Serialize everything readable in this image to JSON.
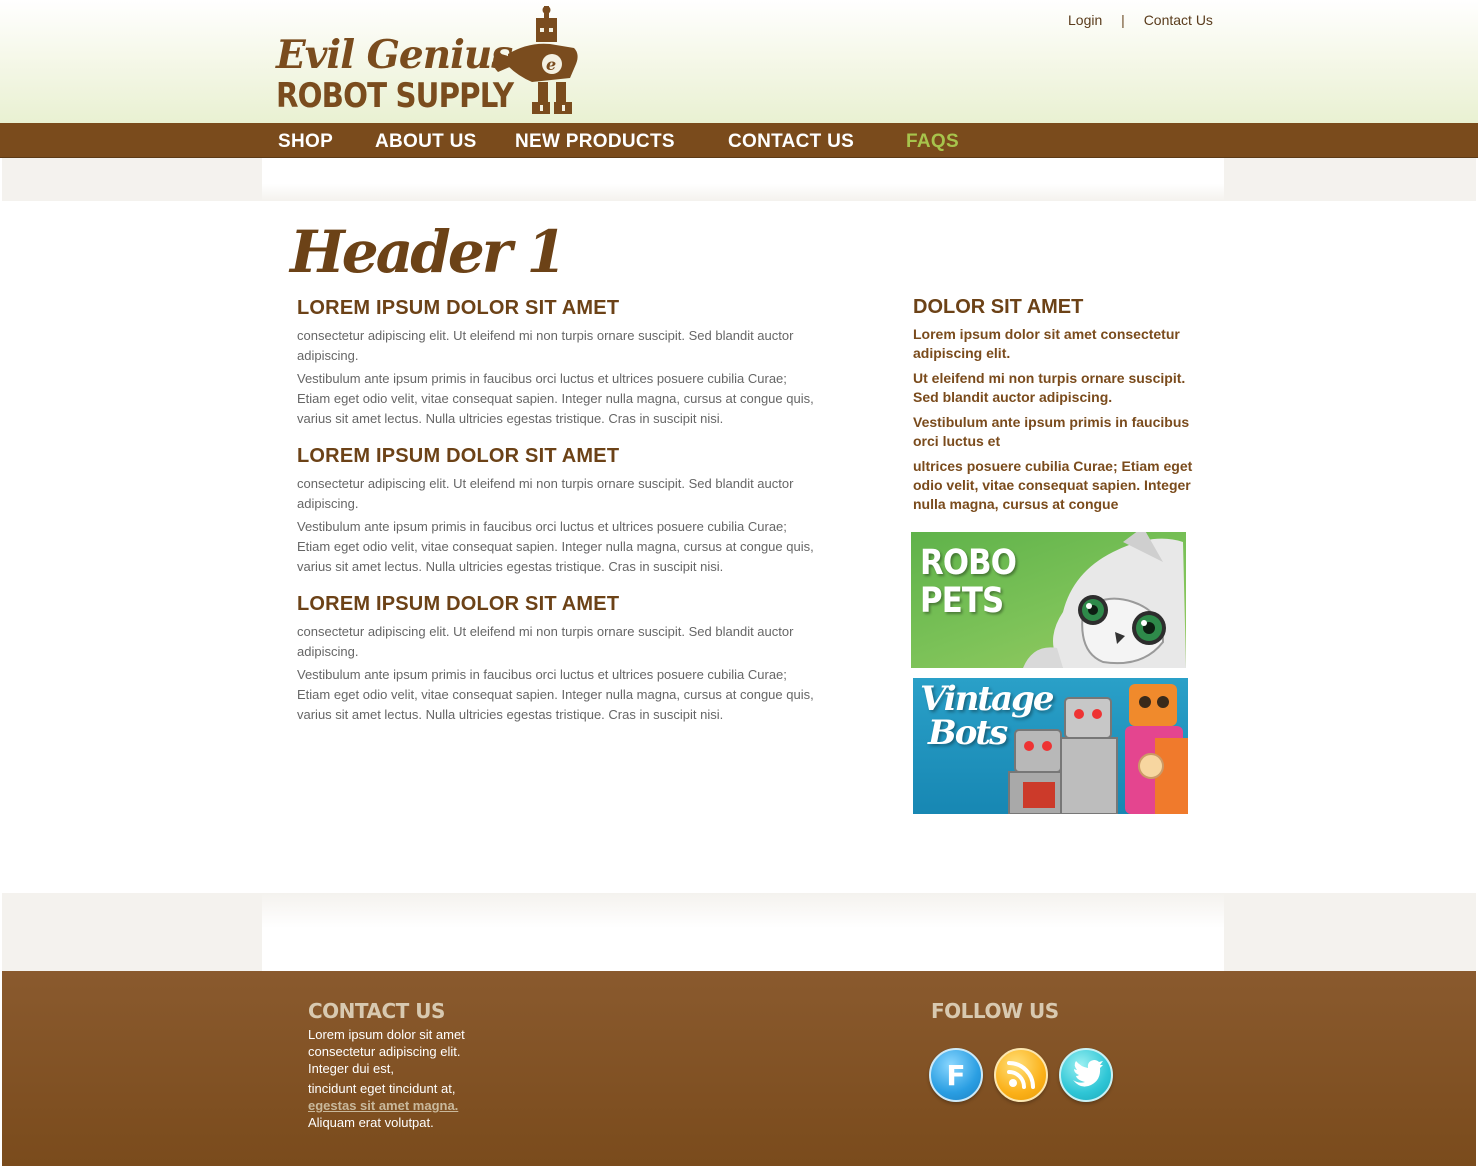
{
  "header": {
    "logo": {
      "line1": "Evil Genius",
      "line2": "ROBOT SUPPLY"
    },
    "top_links": [
      {
        "label": "Login"
      },
      {
        "label": "Contact Us"
      }
    ],
    "separator": "|"
  },
  "nav": {
    "items": [
      {
        "label": "SHOP"
      },
      {
        "label": "ABOUT US"
      },
      {
        "label": "NEW PRODUCTS"
      },
      {
        "label": "CONTACT US"
      },
      {
        "label": "FAQS",
        "active": true
      }
    ]
  },
  "main": {
    "title": "Header 1",
    "sections": [
      {
        "heading": "LOREM IPSUM DOLOR SIT AMET",
        "p1": "consectetur adipiscing elit. Ut eleifend mi non turpis ornare suscipit. Sed blandit auctor adipiscing.",
        "p2": "Vestibulum ante ipsum primis in faucibus orci luctus et ultrices posuere cubilia Curae; Etiam eget odio velit, vitae consequat sapien. Integer nulla magna, cursus at congue quis, varius sit amet lectus. Nulla ultricies egestas tristique. Cras in suscipit nisi."
      },
      {
        "heading": "LOREM IPSUM DOLOR SIT AMET",
        "p1": "consectetur adipiscing elit. Ut eleifend mi non turpis ornare suscipit. Sed blandit auctor adipiscing.",
        "p2": "Vestibulum ante ipsum primis in faucibus orci luctus et ultrices posuere cubilia Curae; Etiam eget odio velit, vitae consequat sapien. Integer nulla magna, cursus at congue quis, varius sit amet lectus. Nulla ultricies egestas tristique. Cras in suscipit nisi."
      },
      {
        "heading": "LOREM IPSUM DOLOR SIT AMET",
        "p1": "consectetur adipiscing elit. Ut eleifend mi non turpis ornare suscipit. Sed blandit auctor adipiscing.",
        "p2": "Vestibulum ante ipsum primis in faucibus orci luctus et ultrices posuere cubilia Curae; Etiam eget odio velit, vitae consequat sapien. Integer nulla magna, cursus at congue quis, varius sit amet lectus. Nulla ultricies egestas tristique. Cras in suscipit nisi."
      }
    ]
  },
  "sidebar": {
    "heading": "DOLOR SIT AMET",
    "paragraphs": [
      "Lorem ipsum dolor sit amet consectetur adipiscing elit.",
      "Ut eleifend mi non turpis ornare suscipit. Sed blandit auctor adipiscing.",
      "Vestibulum ante ipsum primis in faucibus orci luctus et",
      "ultrices posuere cubilia Curae; Etiam eget odio velit, vitae consequat sapien. Integer nulla magna, cursus at congue"
    ],
    "promos": [
      {
        "line1": "ROBO",
        "line2": "PETS"
      },
      {
        "line1": "Vintage",
        "line2": "Bots"
      }
    ]
  },
  "footer": {
    "contact": {
      "heading": "CONTACT US",
      "lines": [
        "Lorem ipsum dolor sit amet",
        "consectetur adipiscing elit.",
        "Integer dui est,",
        "tincidunt eget tincidunt at,"
      ],
      "link": "egestas sit amet magna. ",
      "last_line": "Aliquam erat volutpat."
    },
    "follow": {
      "heading": "FOLLOW US",
      "icons": [
        "facebook-icon",
        "rss-icon",
        "twitter-icon"
      ]
    }
  },
  "colors": {
    "brand_brown": "#7a4b1c",
    "heading_brown": "#6c4217",
    "active_green": "#a7c44c",
    "footer_heading": "#d8c9b0"
  }
}
